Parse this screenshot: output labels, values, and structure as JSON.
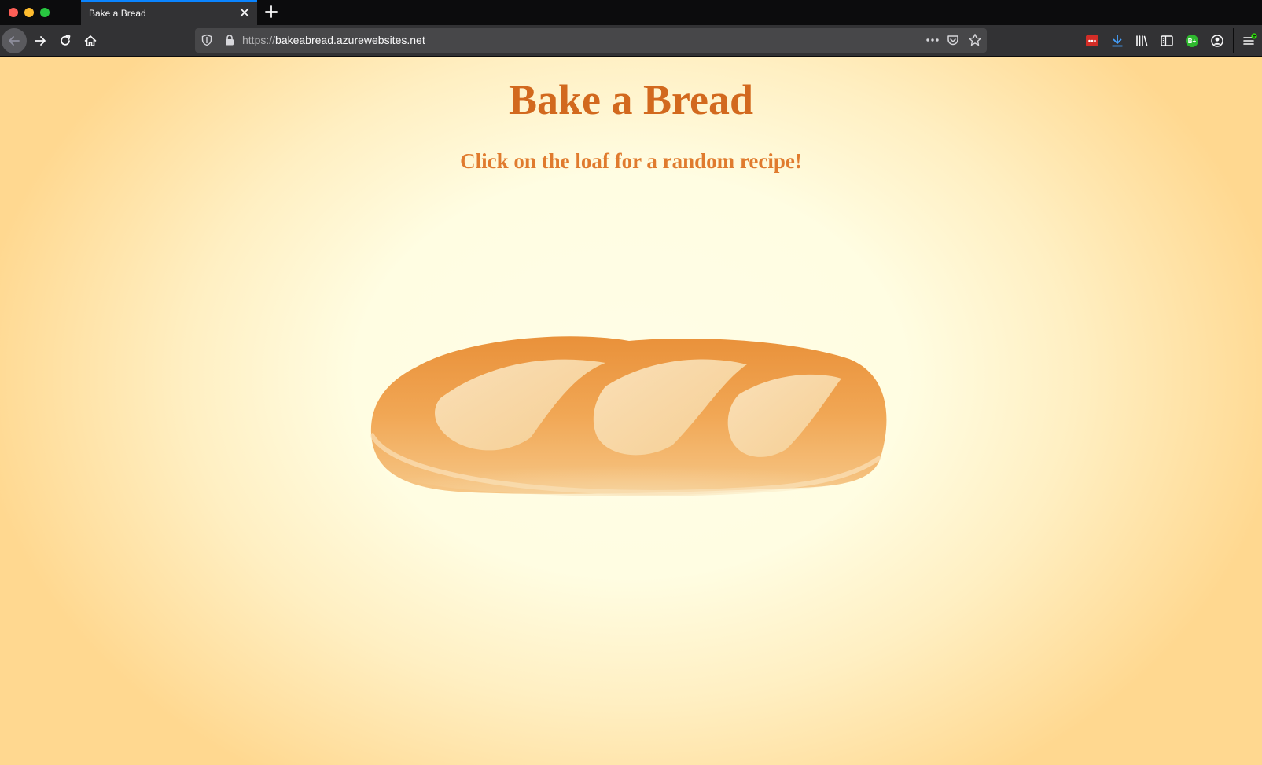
{
  "browser": {
    "tab": {
      "title": "Bake a Bread"
    },
    "url": {
      "protocol": "https://",
      "host": "bakeabread.azurewebsites.net"
    },
    "icons": {
      "back": "back-arrow-icon",
      "forward": "forward-arrow-icon",
      "reload": "reload-icon",
      "home": "home-icon",
      "tracking": "shield-icon",
      "lock": "lock-icon",
      "page_actions": "more-horizontal-icon",
      "pocket": "pocket-icon",
      "bookmark": "star-icon",
      "downloads": "download-icon",
      "library": "library-icon",
      "sidebar": "sidebar-icon",
      "account": "account-icon",
      "menu": "hamburger-menu-icon"
    },
    "extensions": {
      "lastpass_label": "•••",
      "ext_badge": "B+"
    },
    "colors": {
      "tab_accent": "#0a84ff",
      "toolbar": "#323234",
      "urlbar": "#474749"
    }
  },
  "page": {
    "title": "Bake a Bread",
    "subtitle": "Click on the loaf for a random recipe!",
    "colors": {
      "title": "#d2691e",
      "subtitle": "#e07b2e",
      "background_center": "#fffde2",
      "background_edge": "#ffd890"
    }
  }
}
